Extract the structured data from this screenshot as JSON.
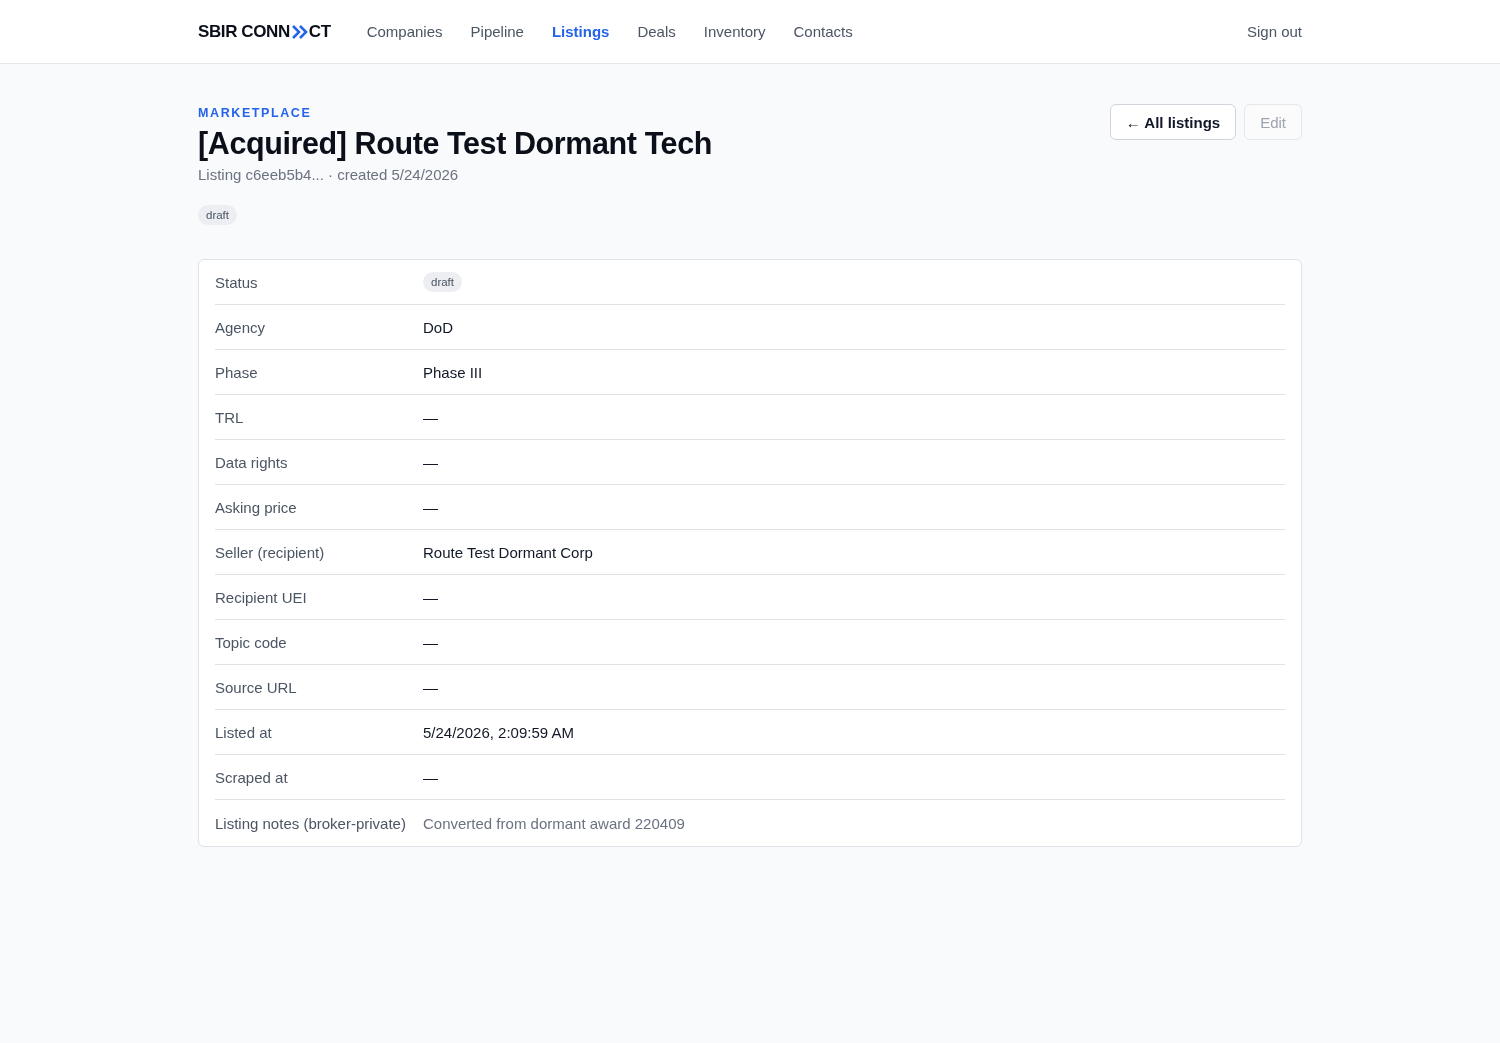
{
  "header": {
    "logo": {
      "text_start": "SBIR CONN",
      "text_end": "CT"
    },
    "nav": [
      {
        "label": "Companies",
        "selected": false
      },
      {
        "label": "Pipeline",
        "selected": false
      },
      {
        "label": "Listings",
        "selected": true
      },
      {
        "label": "Deals",
        "selected": false
      },
      {
        "label": "Inventory",
        "selected": false
      },
      {
        "label": "Contacts",
        "selected": false
      }
    ],
    "sign_out": "Sign out"
  },
  "page": {
    "eyebrow": "MARKETPLACE",
    "title": "[Acquired] Route Test Dormant Tech",
    "subtitle": "Listing c6eeb5b4... · created 5/24/2026",
    "badge": "draft",
    "actions": [
      {
        "label": "← All listings",
        "disabled": false
      },
      {
        "label": "Edit",
        "disabled": true
      }
    ]
  },
  "details": {
    "rows": [
      {
        "label": "Status",
        "kind": "badge",
        "value": "draft"
      },
      {
        "label": "Agency",
        "kind": "text",
        "value": "DoD"
      },
      {
        "label": "Phase",
        "kind": "text",
        "value": "Phase III"
      },
      {
        "label": "TRL",
        "kind": "text",
        "value": "—"
      },
      {
        "label": "Data rights",
        "kind": "text",
        "value": "—"
      },
      {
        "label": "Asking price",
        "kind": "text",
        "value": "—"
      },
      {
        "label": "Seller (recipient)",
        "kind": "text",
        "value": "Route Test Dormant Corp"
      },
      {
        "label": "Recipient UEI",
        "kind": "text",
        "value": "—"
      },
      {
        "label": "Topic code",
        "kind": "text",
        "value": "—"
      },
      {
        "label": "Source URL",
        "kind": "text",
        "value": "—"
      },
      {
        "label": "Listed at",
        "kind": "text",
        "value": "5/24/2026, 2:09:59 AM"
      },
      {
        "label": "Scraped at",
        "kind": "text",
        "value": "—"
      },
      {
        "label": "Listing notes (broker-private)",
        "kind": "note",
        "value": "Converted from dormant award 220409"
      }
    ]
  }
}
